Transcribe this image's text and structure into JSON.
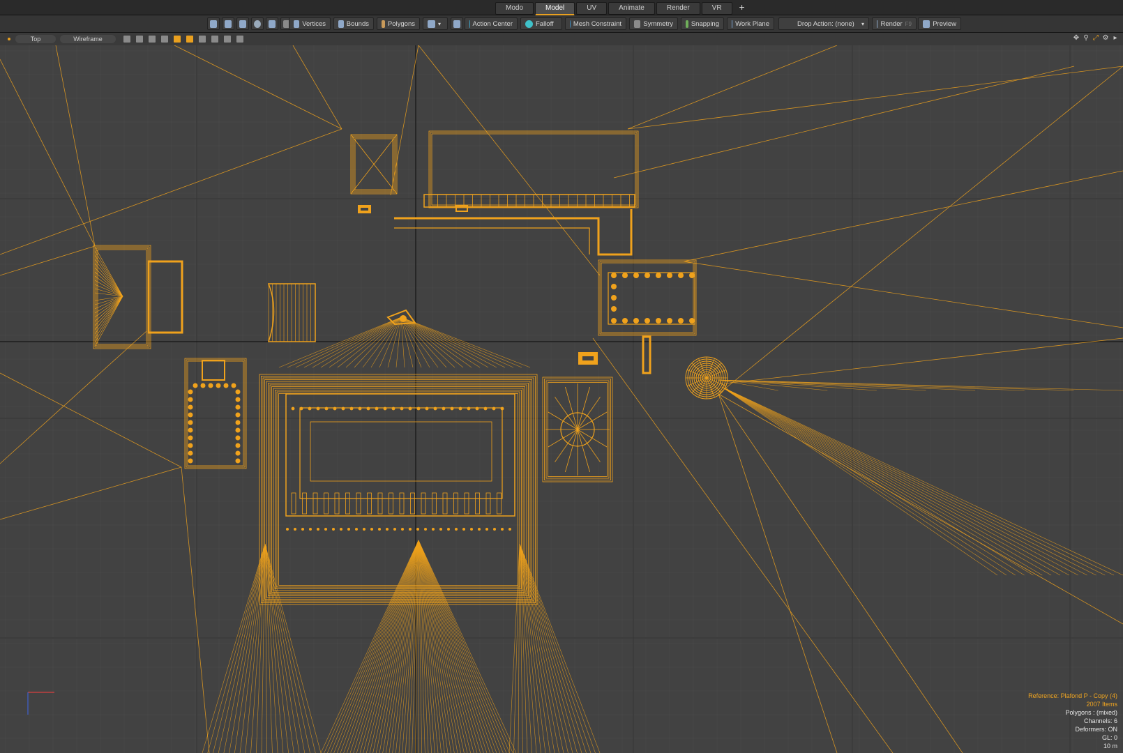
{
  "tabs": [
    {
      "label": "Modo",
      "active": false
    },
    {
      "label": "Model",
      "active": true
    },
    {
      "label": "UV",
      "active": false
    },
    {
      "label": "Animate",
      "active": false
    },
    {
      "label": "Render",
      "active": false
    },
    {
      "label": "VR",
      "active": false
    }
  ],
  "tab_add": "+",
  "toolbar": {
    "vertices": "Vertices",
    "bounds": "Bounds",
    "polygons": "Polygons",
    "action_center": "Action Center",
    "falloff": "Falloff",
    "mesh_constraint": "Mesh Constraint",
    "symmetry": "Symmetry",
    "snapping": "Snapping",
    "work_plane": "Work Plane",
    "drop_action": "Drop Action: (none)",
    "render": "Render",
    "render_key": "F9",
    "preview": "Preview"
  },
  "viewport_header": {
    "view": "Top",
    "shading": "Wireframe"
  },
  "info": {
    "reference": "Reference: Plafond P - Copy (4)",
    "items": "2007 Items",
    "polygons": "Polygons : (mixed)",
    "channels": "Channels: 6",
    "deformers": "Deformers: ON",
    "gl": "GL: 0",
    "scale": "10 m"
  },
  "colors": {
    "wire": "#f0a21c",
    "grid_bg": "#424242",
    "accent": "#e9a01f"
  }
}
